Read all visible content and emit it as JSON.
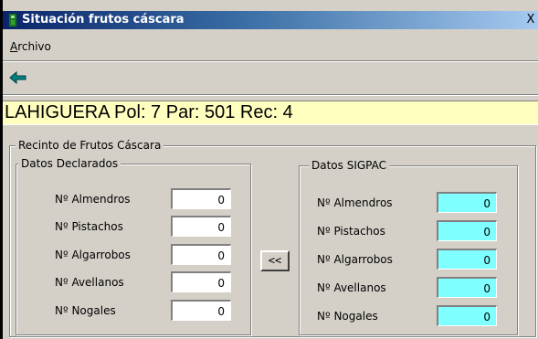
{
  "window": {
    "title": "Situación frutos cáscara",
    "close_glyph": "X"
  },
  "menu": {
    "items": [
      {
        "accel": "A",
        "rest": "rchivo"
      }
    ]
  },
  "toolbar": {
    "back_icon": "arrow-left-icon"
  },
  "header": {
    "text": "LAHIGUERA Pol: 7 Par: 501 Rec: 4",
    "background": "#ffffc0"
  },
  "recinto": {
    "title": "Recinto de Frutos Cáscara",
    "declarados": {
      "title": "Datos Declarados",
      "rows": [
        {
          "label": "Nº Almendros",
          "value": "0"
        },
        {
          "label": "Nº Pistachos",
          "value": "0"
        },
        {
          "label": "Nº Algarrobos",
          "value": "0"
        },
        {
          "label": "Nº Avellanos",
          "value": "0"
        },
        {
          "label": "Nº Nogales",
          "value": "0"
        }
      ]
    },
    "copy_button": {
      "label": "<<"
    },
    "sigpac": {
      "title": "Datos SIGPAC",
      "field_color": "#7fffff",
      "rows": [
        {
          "label": "Nº Almendros",
          "value": "0"
        },
        {
          "label": "Nº Pistachos",
          "value": "0"
        },
        {
          "label": "Nº Algarrobos",
          "value": "0"
        },
        {
          "label": "Nº Avellanos",
          "value": "0"
        },
        {
          "label": "Nº Nogales",
          "value": "0"
        }
      ]
    }
  }
}
